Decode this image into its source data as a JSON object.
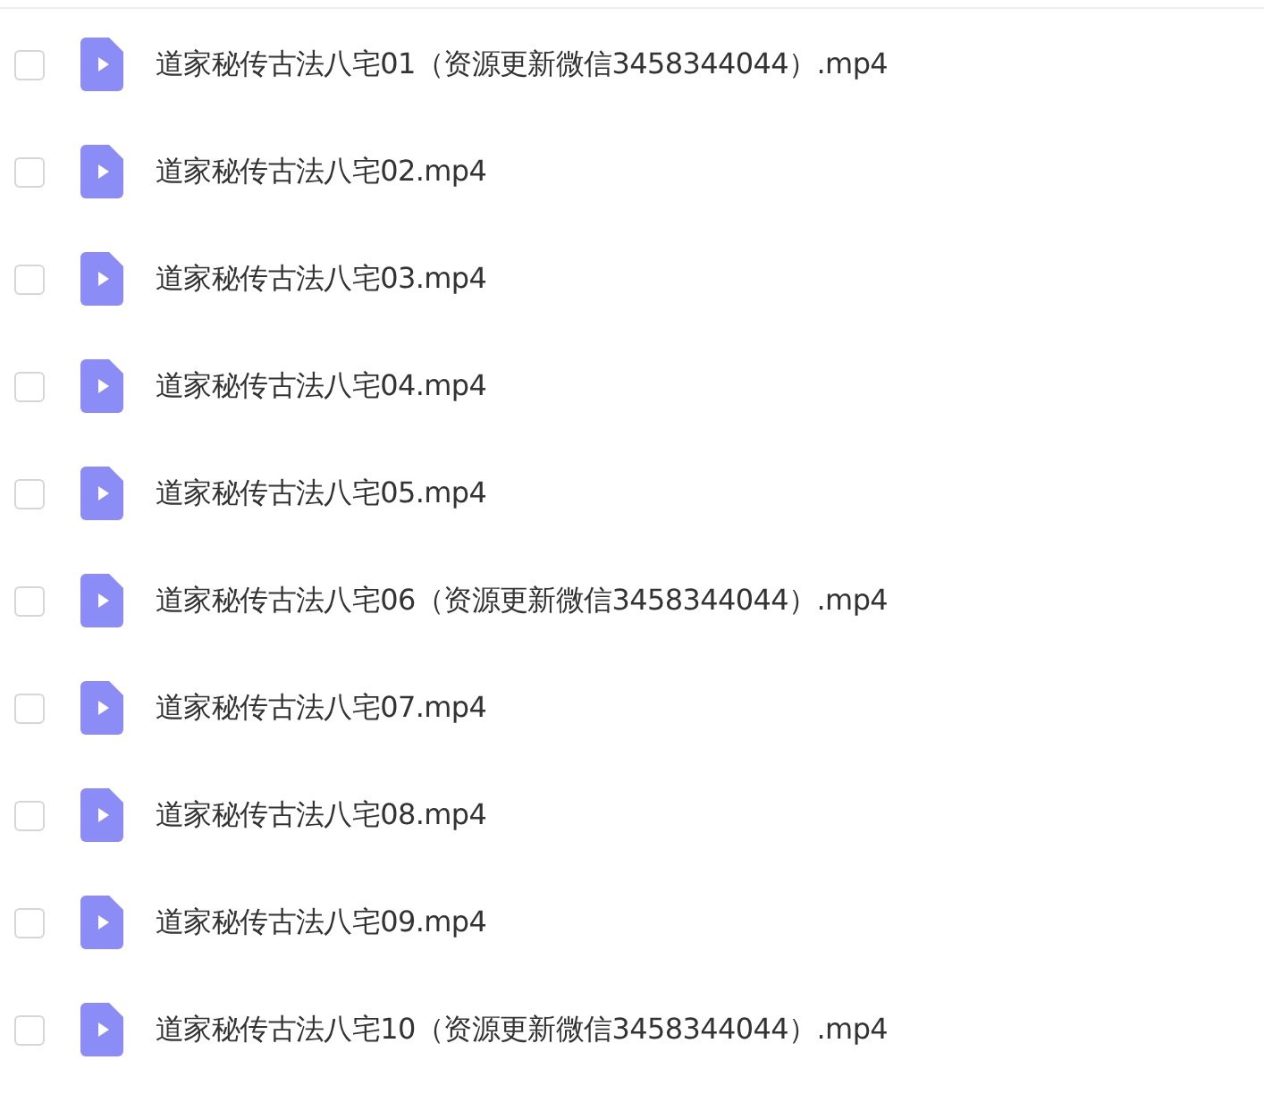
{
  "files": [
    {
      "name": "道家秘传古法八宅01（资源更新微信3458344044）.mp4",
      "checked": false
    },
    {
      "name": "道家秘传古法八宅02.mp4",
      "checked": false
    },
    {
      "name": "道家秘传古法八宅03.mp4",
      "checked": false
    },
    {
      "name": "道家秘传古法八宅04.mp4",
      "checked": false
    },
    {
      "name": "道家秘传古法八宅05.mp4",
      "checked": false
    },
    {
      "name": "道家秘传古法八宅06（资源更新微信3458344044）.mp4",
      "checked": false
    },
    {
      "name": "道家秘传古法八宅07.mp4",
      "checked": false
    },
    {
      "name": "道家秘传古法八宅08.mp4",
      "checked": false
    },
    {
      "name": "道家秘传古法八宅09.mp4",
      "checked": false
    },
    {
      "name": "道家秘传古法八宅10（资源更新微信3458344044）.mp4",
      "checked": false
    }
  ]
}
